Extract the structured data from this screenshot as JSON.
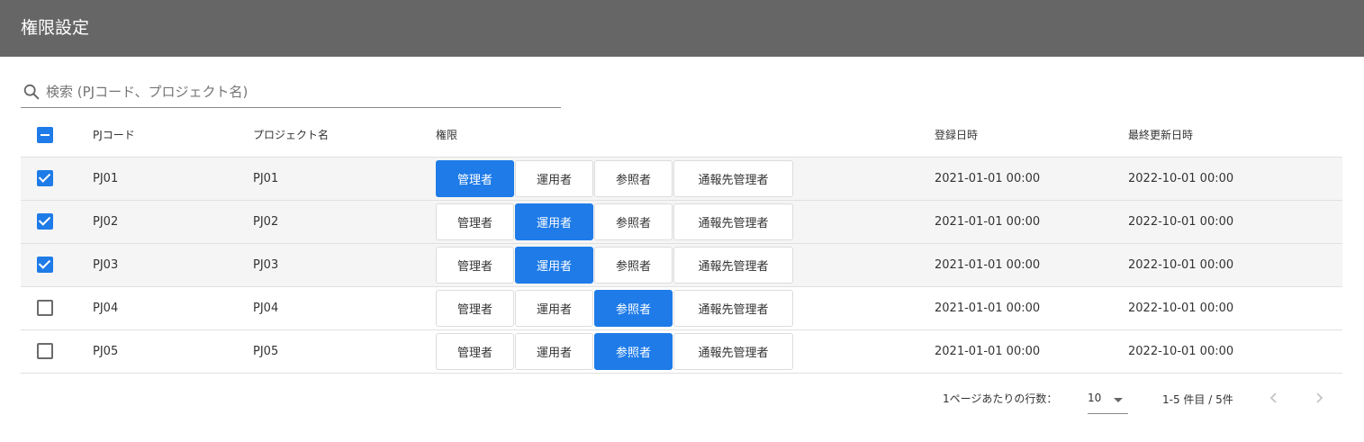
{
  "header": {
    "title": "権限設定"
  },
  "search": {
    "placeholder": "検索 (PJコード、プロジェクト名)",
    "value": ""
  },
  "table": {
    "headers": {
      "code": "PJコード",
      "name": "プロジェクト名",
      "permission": "権限",
      "registered": "登録日時",
      "updated": "最終更新日時"
    },
    "select_all_state": "indeterminate",
    "permission_options": [
      "管理者",
      "運用者",
      "参照者",
      "通報先管理者"
    ],
    "rows": [
      {
        "checked": true,
        "code": "PJ01",
        "name": "PJ01",
        "active_permission": "管理者",
        "registered": "2021-01-01 00:00",
        "updated": "2022-10-01 00:00"
      },
      {
        "checked": true,
        "code": "PJ02",
        "name": "PJ02",
        "active_permission": "運用者",
        "registered": "2021-01-01 00:00",
        "updated": "2022-10-01 00:00"
      },
      {
        "checked": true,
        "code": "PJ03",
        "name": "PJ03",
        "active_permission": "運用者",
        "registered": "2021-01-01 00:00",
        "updated": "2022-10-01 00:00"
      },
      {
        "checked": false,
        "code": "PJ04",
        "name": "PJ04",
        "active_permission": "参照者",
        "registered": "2021-01-01 00:00",
        "updated": "2022-10-01 00:00"
      },
      {
        "checked": false,
        "code": "PJ05",
        "name": "PJ05",
        "active_permission": "参照者",
        "registered": "2021-01-01 00:00",
        "updated": "2022-10-01 00:00"
      }
    ]
  },
  "pagination": {
    "rows_per_page_label": "1ページあたりの行数：",
    "rows_per_page": "10",
    "range": "1-5 件目 / 5件"
  },
  "colors": {
    "header_bg": "#666666",
    "accent": "#1e7be8",
    "selected_row_bg": "#f5f5f5"
  },
  "icons": {
    "search": "search-icon",
    "rows_select": "caret-down-icon",
    "prev": "chevron-left-icon",
    "next": "chevron-right-icon"
  }
}
